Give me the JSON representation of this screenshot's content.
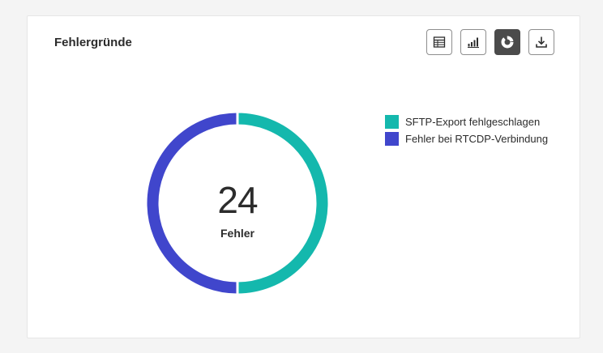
{
  "card": {
    "title": "Fehlergründe"
  },
  "toolbar": {
    "buttons": [
      {
        "name": "table-view",
        "icon": "table-icon",
        "active": false
      },
      {
        "name": "bar-chart-view",
        "icon": "bar-chart-icon",
        "active": false
      },
      {
        "name": "donut-chart-view",
        "icon": "donut-chart-icon",
        "active": true
      },
      {
        "name": "download",
        "icon": "download-icon",
        "active": false
      }
    ]
  },
  "summary": {
    "total": "24",
    "label": "Fehler"
  },
  "colors": {
    "teal": "#14b8ad",
    "indigo": "#4046cc"
  },
  "chart_data": {
    "type": "pie",
    "categories": [
      "SFTP-Export fehlgeschlagen",
      "Fehler bei RTCDP-Verbindung"
    ],
    "values": [
      12,
      12
    ],
    "colors": [
      "#14b8ad",
      "#4046cc"
    ],
    "legend": "right"
  }
}
